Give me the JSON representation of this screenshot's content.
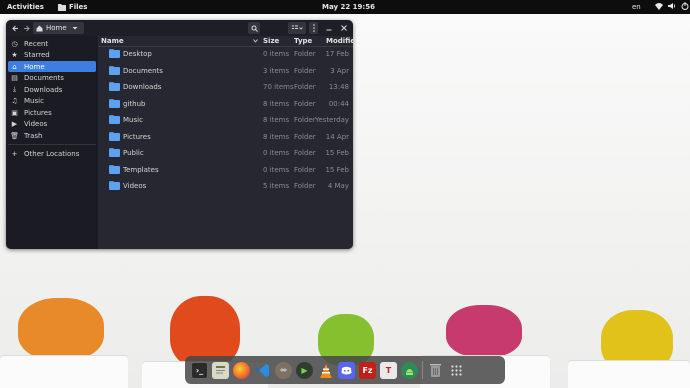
{
  "topbar": {
    "activities": "Activities",
    "app_name": "Files",
    "clock": "May 22  19:56",
    "language": "en"
  },
  "window": {
    "path": "Home"
  },
  "sidebar": {
    "items": [
      {
        "label": "Recent",
        "icon": "clock-icon"
      },
      {
        "label": "Starred",
        "icon": "star-icon"
      },
      {
        "label": "Home",
        "icon": "home-icon"
      },
      {
        "label": "Documents",
        "icon": "document-icon"
      },
      {
        "label": "Downloads",
        "icon": "download-icon"
      },
      {
        "label": "Music",
        "icon": "music-icon"
      },
      {
        "label": "Pictures",
        "icon": "picture-icon"
      },
      {
        "label": "Videos",
        "icon": "video-icon"
      },
      {
        "label": "Trash",
        "icon": "trash-icon"
      }
    ],
    "other": {
      "label": "Other Locations",
      "icon": "plus-icon"
    }
  },
  "table": {
    "columns": {
      "name": "Name",
      "size": "Size",
      "type": "Type",
      "modified": "Modified"
    },
    "rows": [
      {
        "name": "Desktop",
        "size": "0 items",
        "type": "Folder",
        "modified": "17 Feb"
      },
      {
        "name": "Documents",
        "size": "3 items",
        "type": "Folder",
        "modified": "3 Apr"
      },
      {
        "name": "Downloads",
        "size": "70 items",
        "type": "Folder",
        "modified": "13:48"
      },
      {
        "name": "github",
        "size": "8 items",
        "type": "Folder",
        "modified": "00:44"
      },
      {
        "name": "Music",
        "size": "8 items",
        "type": "Folder",
        "modified": "Yesterday"
      },
      {
        "name": "Pictures",
        "size": "8 items",
        "type": "Folder",
        "modified": "14 Apr"
      },
      {
        "name": "Public",
        "size": "0 items",
        "type": "Folder",
        "modified": "15 Feb"
      },
      {
        "name": "Templates",
        "size": "0 items",
        "type": "Folder",
        "modified": "15 Feb"
      },
      {
        "name": "Videos",
        "size": "5 items",
        "type": "Folder",
        "modified": "4 May"
      }
    ]
  },
  "dock": {
    "apps": [
      "terminal",
      "text-editor",
      "firefox",
      "vscode",
      "gimp",
      "android-studio",
      "vlc",
      "discord",
      "filezilla",
      "typora",
      "android-file-transfer",
      "trash",
      "app-grid"
    ]
  },
  "colors": {
    "accent": "#3d7ee0",
    "folder": "#5da2f0",
    "window_bg": "#242530"
  }
}
